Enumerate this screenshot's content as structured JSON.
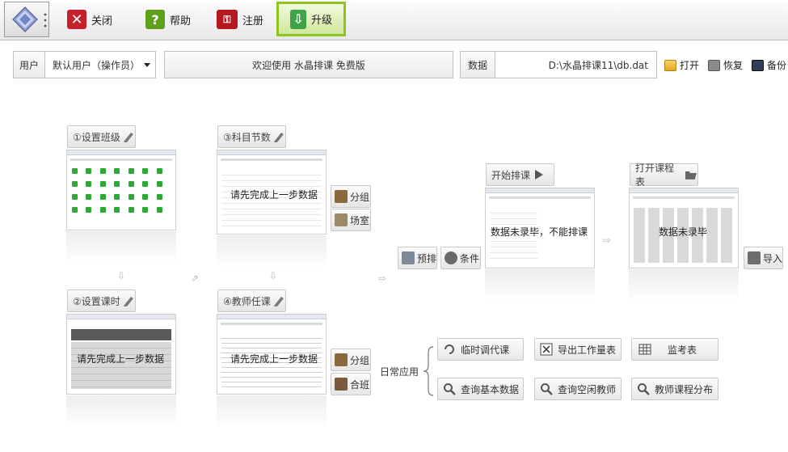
{
  "toolbar": {
    "close_label": "关闭",
    "help_label": "帮助",
    "register_label": "注册",
    "upgrade_label": "升级",
    "help_icon_glyph": "?"
  },
  "infobar": {
    "user_label": "用户",
    "user_value": "默认用户（操作员）",
    "welcome_text": "欢迎使用 水晶排课 免费版",
    "data_label": "数据",
    "data_path": "D:\\水晶排课11\\db.dat",
    "open_label": "打开",
    "restore_label": "恢复",
    "backup_label": "备份"
  },
  "steps": {
    "step1": "①设置班级",
    "step2": "②设置课时",
    "step3": "③科目节数",
    "step4": "④教师任课",
    "start": "开始排课",
    "open_table": "打开课程表"
  },
  "messages": {
    "complete_prev": "请先完成上一步数据",
    "data_not_entered_cannot": "数据未录毕，不能排课",
    "data_not_entered": "数据未录毕"
  },
  "side_buttons": {
    "group": "分组",
    "room": "场室",
    "prearrange": "预排",
    "conditions": "条件",
    "import": "导入",
    "combine": "合班"
  },
  "daily": {
    "label": "日常应用",
    "items": [
      "临时调代课",
      "导出工作量表",
      "监考表",
      "查询基本数据",
      "查询空闲教师",
      "教师课程分布"
    ]
  },
  "colors": {
    "upgrade_border": "#8fc31f",
    "close_red": "#c8202a",
    "help_green": "#5ea11a",
    "register_red": "#b5181e",
    "upgrade_icon_green": "#3fa34a"
  }
}
